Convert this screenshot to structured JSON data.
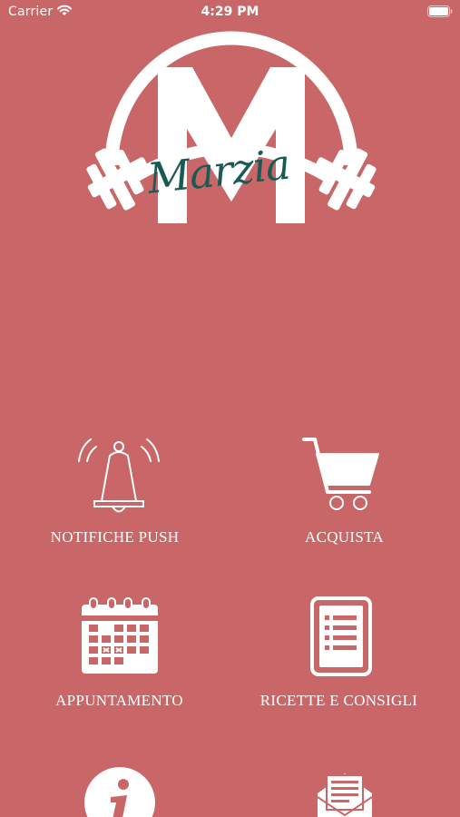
{
  "colors": {
    "background": "#c96667",
    "foreground": "#ffffff",
    "logo_script": "#1a5a55"
  },
  "status_bar": {
    "carrier": "Carrier",
    "time": "4:29 PM"
  },
  "logo": {
    "letter": "M",
    "script_text": "Marzia"
  },
  "menu": {
    "items": [
      {
        "label": "NOTIFICHE PUSH",
        "icon": "bell-icon"
      },
      {
        "label": "ACQUISTA",
        "icon": "cart-icon"
      },
      {
        "label": "APPUNTAMENTO",
        "icon": "calendar-icon"
      },
      {
        "label": "RICETTE E CONSIGLI",
        "icon": "document-list-icon"
      },
      {
        "label": "",
        "icon": "info-icon"
      },
      {
        "label": "",
        "icon": "mail-icon"
      }
    ]
  }
}
